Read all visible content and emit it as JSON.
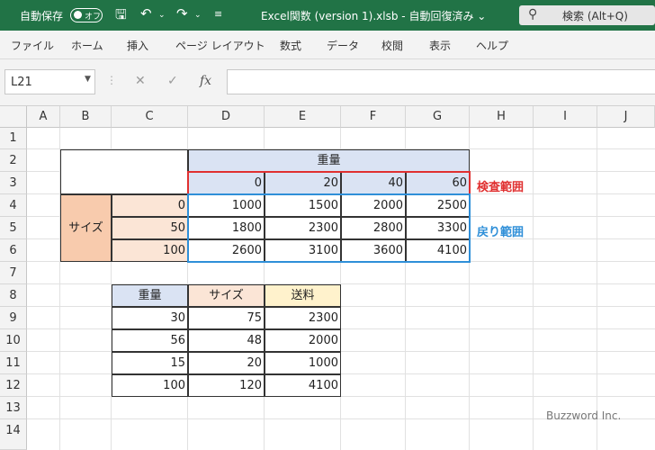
{
  "titlebar": {
    "autosave_label": "自動保存",
    "autosave_state": "オフ",
    "file_title": "Excel関数 (version 1).xlsb  -  自動回復済み  ⌄",
    "search_label": "検索 (Alt+Q)"
  },
  "ribbon_tabs": [
    "ファイル",
    "ホーム",
    "挿入",
    "ページ レイアウト",
    "数式",
    "データ",
    "校閲",
    "表示",
    "ヘルプ"
  ],
  "formula_bar": {
    "name_box": "L21",
    "cancel": "✕",
    "enter": "✓",
    "fx": "fx",
    "formula": ""
  },
  "columns": [
    "A",
    "B",
    "C",
    "D",
    "E",
    "F",
    "G",
    "H",
    "I",
    "J"
  ],
  "rows": [
    "1",
    "2",
    "3",
    "4",
    "5",
    "6",
    "7",
    "8",
    "9",
    "10",
    "11",
    "12",
    "13",
    "14"
  ],
  "table1": {
    "header": "重量",
    "weights": [
      "0",
      "20",
      "40",
      "60"
    ],
    "size_label": "サイズ",
    "sizes": [
      "0",
      "50",
      "100"
    ],
    "values": [
      [
        "1000",
        "1500",
        "2000",
        "2500"
      ],
      [
        "1800",
        "2300",
        "2800",
        "3300"
      ],
      [
        "2600",
        "3100",
        "3600",
        "4100"
      ]
    ]
  },
  "labels": {
    "lookup_range": "検査範囲",
    "return_range": "戻り範囲"
  },
  "table2": {
    "headers": [
      "重量",
      "サイズ",
      "送料"
    ],
    "rows": [
      [
        "30",
        "75",
        "2300"
      ],
      [
        "56",
        "48",
        "2000"
      ],
      [
        "15",
        "20",
        "1000"
      ],
      [
        "100",
        "120",
        "4100"
      ]
    ]
  },
  "watermark": "Buzzword Inc.",
  "colors": {
    "accent": "#217346",
    "header_blue": "#dae3f3",
    "header_peach": "#fbe5d6",
    "size_orange": "#f8cbad",
    "header_yellow": "#fff2cc",
    "red": "#e03030",
    "blue": "#2f8fd8"
  }
}
